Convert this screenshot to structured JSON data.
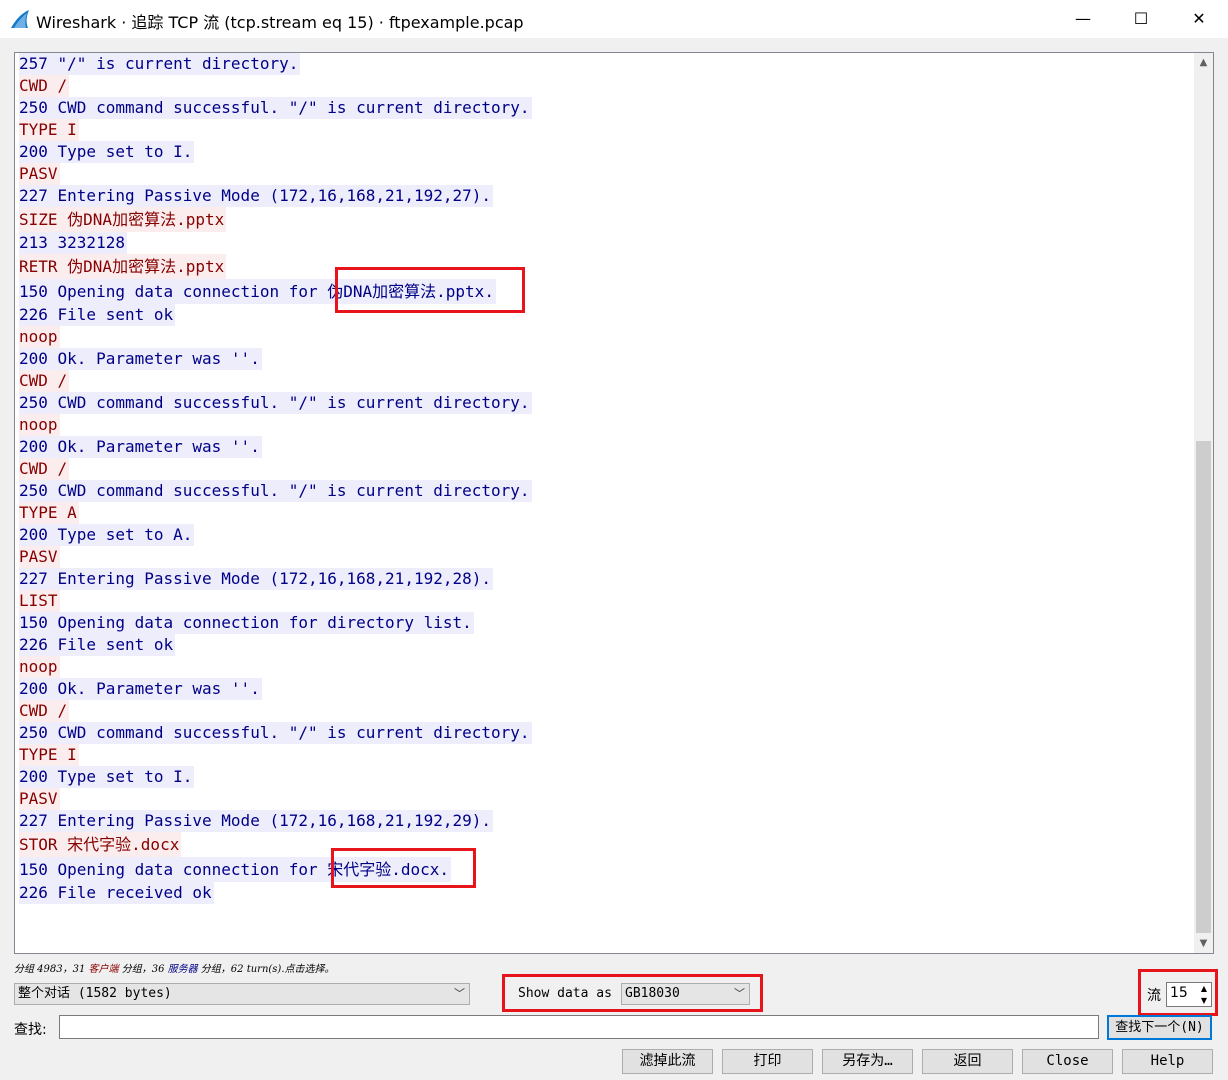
{
  "window": {
    "title": "Wireshark · 追踪 TCP 流 (tcp.stream eq 15) · ftpexample.pcap",
    "minimize_glyph": "—",
    "maximize_glyph": "☐",
    "close_glyph": "✕",
    "app_icon": "wireshark-fin-icon"
  },
  "stream": {
    "lines": [
      {
        "side": "server",
        "text": "257 \"/\" is current directory."
      },
      {
        "side": "client",
        "text": "CWD /"
      },
      {
        "side": "server",
        "text": "250 CWD command successful. \"/\" is current directory."
      },
      {
        "side": "client",
        "text": "TYPE I"
      },
      {
        "side": "server",
        "text": "200 Type set to I."
      },
      {
        "side": "client",
        "text": "PASV"
      },
      {
        "side": "server",
        "text": "227 Entering Passive Mode (172,16,168,21,192,27)."
      },
      {
        "side": "client",
        "text": "SIZE 伪DNA加密算法.pptx"
      },
      {
        "side": "server",
        "text": "213 3232128"
      },
      {
        "side": "client",
        "text": "RETR 伪DNA加密算法.pptx"
      },
      {
        "side": "server",
        "text": "150 Opening data connection for 伪DNA加密算法.pptx."
      },
      {
        "side": "server",
        "text": "226 File sent ok"
      },
      {
        "side": "client",
        "text": "noop"
      },
      {
        "side": "server",
        "text": "200 Ok. Parameter was ''."
      },
      {
        "side": "client",
        "text": "CWD /"
      },
      {
        "side": "server",
        "text": "250 CWD command successful. \"/\" is current directory."
      },
      {
        "side": "client",
        "text": "noop"
      },
      {
        "side": "server",
        "text": "200 Ok. Parameter was ''."
      },
      {
        "side": "client",
        "text": "CWD /"
      },
      {
        "side": "server",
        "text": "250 CWD command successful. \"/\" is current directory."
      },
      {
        "side": "client",
        "text": "TYPE A"
      },
      {
        "side": "server",
        "text": "200 Type set to A."
      },
      {
        "side": "client",
        "text": "PASV"
      },
      {
        "side": "server",
        "text": "227 Entering Passive Mode (172,16,168,21,192,28)."
      },
      {
        "side": "client",
        "text": "LIST"
      },
      {
        "side": "server",
        "text": "150 Opening data connection for directory list."
      },
      {
        "side": "server",
        "text": "226 File sent ok"
      },
      {
        "side": "client",
        "text": "noop"
      },
      {
        "side": "server",
        "text": "200 Ok. Parameter was ''."
      },
      {
        "side": "client",
        "text": "CWD /"
      },
      {
        "side": "server",
        "text": "250 CWD command successful. \"/\" is current directory."
      },
      {
        "side": "client",
        "text": "TYPE I"
      },
      {
        "side": "server",
        "text": "200 Type set to I."
      },
      {
        "side": "client",
        "text": "PASV"
      },
      {
        "side": "server",
        "text": "227 Entering Passive Mode (172,16,168,21,192,29)."
      },
      {
        "side": "client",
        "text": "STOR 宋代字验.docx"
      },
      {
        "side": "server",
        "text": "150 Opening data connection for 宋代字验.docx."
      },
      {
        "side": "server",
        "text": "226 File received ok"
      }
    ],
    "colors": {
      "client_fg": "#870000",
      "client_bg": "#fbeded",
      "server_fg": "#000087",
      "server_bg": "#ededfb",
      "highlight": "#e8141c"
    }
  },
  "status": {
    "prefix": "分组 4983，31 ",
    "client_word": "客户端",
    "middle": " 分组，36 ",
    "server_word": "服务器",
    "suffix": " 分组，62 turn(s).点击选择。"
  },
  "conversation_select": {
    "value": "整个对话 (1582 bytes)"
  },
  "show_data": {
    "label": "Show data as",
    "value": "GB18030"
  },
  "stream_index": {
    "label": "流",
    "value": "15"
  },
  "find": {
    "label": "查找:",
    "value": "",
    "next_button": "查找下一个(N)"
  },
  "buttons": {
    "filter_out": "滤掉此流",
    "print": "打印",
    "save_as": "另存为…",
    "back": "返回",
    "close": "Close",
    "help": "Help"
  }
}
